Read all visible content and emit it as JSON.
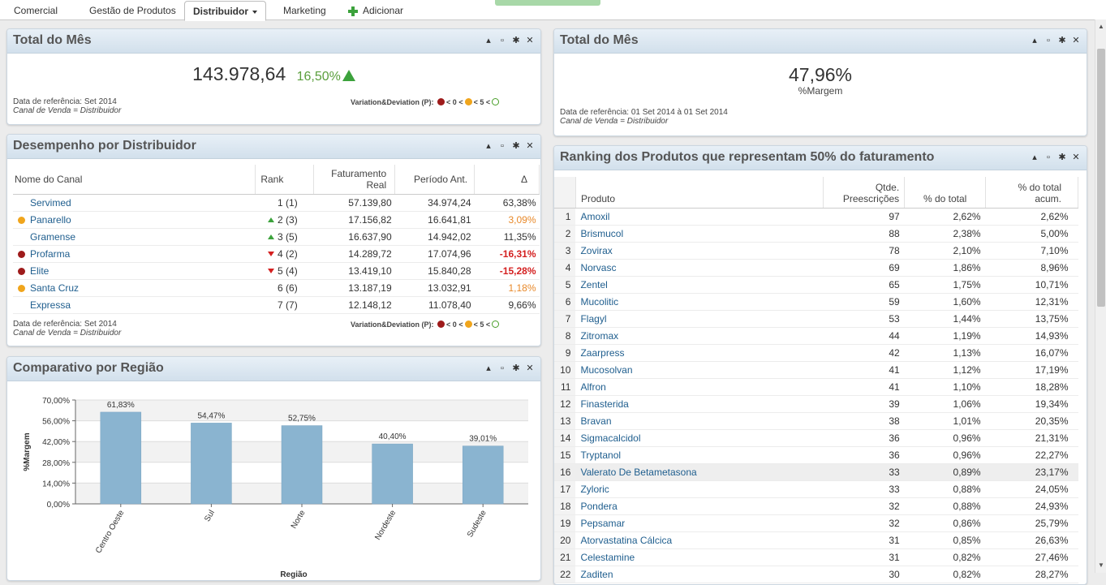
{
  "tabs": [
    {
      "label": "Comercial"
    },
    {
      "label": "Gestão de Produtos"
    },
    {
      "label": "Distribuidor"
    },
    {
      "label": "Marketing"
    },
    {
      "label": "Adicionar"
    }
  ],
  "panel_total_left": {
    "title": "Total do Mês",
    "value": "143.978,64",
    "variation": "16,50%",
    "ref_line1": "Data de referência: Set 2014",
    "ref_line2": "Canal de Venda = Distribuidor",
    "legend_label": "Variation&Deviation (P):",
    "legend_lt0": "< 0",
    "legend_lt5a": "<",
    "legend_lt5b": "< 5",
    "legend_lt5c": "<"
  },
  "panel_total_right": {
    "title": "Total do Mês",
    "value": "47,96%",
    "label": "%Margem",
    "ref_line1": "Data de referência: 01 Set 2014 à 01 Set 2014",
    "ref_line2": "Canal de Venda = Distribuidor"
  },
  "panel_desempenho": {
    "title": "Desempenho por Distribuidor",
    "headers": [
      "Nome do Canal",
      "Rank",
      "Faturamento Real",
      "Período Ant.",
      "Δ"
    ],
    "rows": [
      {
        "name": "Servimed",
        "status": "none",
        "trend": "none",
        "rank": "1",
        "prev_rank": "(1)",
        "faturamento": "57.139,80",
        "periodo": "34.974,24",
        "delta": "63,38%",
        "delta_style": "normal"
      },
      {
        "name": "Panarello",
        "status": "orange",
        "trend": "up",
        "rank": "2",
        "prev_rank": "(3)",
        "faturamento": "17.156,82",
        "periodo": "16.641,81",
        "delta": "3,09%",
        "delta_style": "warn"
      },
      {
        "name": "Gramense",
        "status": "none",
        "trend": "up",
        "rank": "3",
        "prev_rank": "(5)",
        "faturamento": "16.637,90",
        "periodo": "14.942,02",
        "delta": "11,35%",
        "delta_style": "normal"
      },
      {
        "name": "Profarma",
        "status": "red",
        "trend": "down",
        "rank": "4",
        "prev_rank": "(2)",
        "faturamento": "14.289,72",
        "periodo": "17.074,96",
        "delta": "-16,31%",
        "delta_style": "neg"
      },
      {
        "name": "Elite",
        "status": "red",
        "trend": "down",
        "rank": "5",
        "prev_rank": "(4)",
        "faturamento": "13.419,10",
        "periodo": "15.840,28",
        "delta": "-15,28%",
        "delta_style": "neg"
      },
      {
        "name": "Santa Cruz",
        "status": "orange",
        "trend": "none",
        "rank": "6",
        "prev_rank": "(6)",
        "faturamento": "13.187,19",
        "periodo": "13.032,91",
        "delta": "1,18%",
        "delta_style": "warn"
      },
      {
        "name": "Expressa",
        "status": "none",
        "trend": "none",
        "rank": "7",
        "prev_rank": "(7)",
        "faturamento": "12.148,12",
        "periodo": "11.078,40",
        "delta": "9,66%",
        "delta_style": "normal"
      }
    ],
    "ref_line1": "Data de referência: Set 2014",
    "ref_line2": "Canal de Venda = Distribuidor",
    "legend_label": "Variation&Deviation (P):",
    "legend_lt0": "< 0",
    "legend_lt5a": "<",
    "legend_lt5b": "< 5",
    "legend_lt5c": "<"
  },
  "panel_comparativo": {
    "title": "Comparativo por Região"
  },
  "chart_data": {
    "type": "bar",
    "categories": [
      "Centro Oeste",
      "Sul",
      "Norte",
      "Nordeste",
      "Sudeste"
    ],
    "values": [
      61.83,
      54.47,
      52.75,
      40.4,
      39.01
    ],
    "value_labels": [
      "61,83%",
      "54,47%",
      "52,75%",
      "40,40%",
      "39,01%"
    ],
    "ylabel": "%Margem",
    "xlabel": "Região",
    "ylim": [
      0,
      70
    ],
    "yticks": [
      0,
      14,
      28,
      42,
      56,
      70
    ],
    "ytick_labels": [
      "0,00%",
      "14,00%",
      "28,00%",
      "42,00%",
      "56,00%",
      "70,00%"
    ],
    "bar_color": "#8ab4d0",
    "grid": "alternating bands"
  },
  "panel_ranking": {
    "title": "Ranking dos Produtos que representam 50% do faturamento",
    "headers": [
      "Produto",
      "Qtde. Preescrições",
      "% do total",
      "% do total acum."
    ],
    "rows": [
      {
        "idx": "1",
        "produto": "Amoxil",
        "qtde": "97",
        "pct": "2,62%",
        "acum": "2,62%"
      },
      {
        "idx": "2",
        "produto": "Brismucol",
        "qtde": "88",
        "pct": "2,38%",
        "acum": "5,00%"
      },
      {
        "idx": "3",
        "produto": "Zovirax",
        "qtde": "78",
        "pct": "2,10%",
        "acum": "7,10%"
      },
      {
        "idx": "4",
        "produto": "Norvasc",
        "qtde": "69",
        "pct": "1,86%",
        "acum": "8,96%"
      },
      {
        "idx": "5",
        "produto": "Zentel",
        "qtde": "65",
        "pct": "1,75%",
        "acum": "10,71%"
      },
      {
        "idx": "6",
        "produto": "Mucolitic",
        "qtde": "59",
        "pct": "1,60%",
        "acum": "12,31%"
      },
      {
        "idx": "7",
        "produto": "Flagyl",
        "qtde": "53",
        "pct": "1,44%",
        "acum": "13,75%"
      },
      {
        "idx": "8",
        "produto": "Zitromax",
        "qtde": "44",
        "pct": "1,19%",
        "acum": "14,93%"
      },
      {
        "idx": "9",
        "produto": "Zaarpress",
        "qtde": "42",
        "pct": "1,13%",
        "acum": "16,07%"
      },
      {
        "idx": "10",
        "produto": "Mucosolvan",
        "qtde": "41",
        "pct": "1,12%",
        "acum": "17,19%"
      },
      {
        "idx": "11",
        "produto": "Alfron",
        "qtde": "41",
        "pct": "1,10%",
        "acum": "18,28%"
      },
      {
        "idx": "12",
        "produto": "Finasterida",
        "qtde": "39",
        "pct": "1,06%",
        "acum": "19,34%"
      },
      {
        "idx": "13",
        "produto": "Bravan",
        "qtde": "38",
        "pct": "1,01%",
        "acum": "20,35%"
      },
      {
        "idx": "14",
        "produto": "Sigmacalcidol",
        "qtde": "36",
        "pct": "0,96%",
        "acum": "21,31%"
      },
      {
        "idx": "15",
        "produto": "Tryptanol",
        "qtde": "36",
        "pct": "0,96%",
        "acum": "22,27%"
      },
      {
        "idx": "16",
        "produto": "Valerato De Betametasona",
        "qtde": "33",
        "pct": "0,89%",
        "acum": "23,17%"
      },
      {
        "idx": "17",
        "produto": "Zyloric",
        "qtde": "33",
        "pct": "0,88%",
        "acum": "24,05%"
      },
      {
        "idx": "18",
        "produto": "Pondera",
        "qtde": "32",
        "pct": "0,88%",
        "acum": "24,93%"
      },
      {
        "idx": "19",
        "produto": "Pepsamar",
        "qtde": "32",
        "pct": "0,86%",
        "acum": "25,79%"
      },
      {
        "idx": "20",
        "produto": "Atorvastatina Cálcica",
        "qtde": "31",
        "pct": "0,85%",
        "acum": "26,63%"
      },
      {
        "idx": "21",
        "produto": "Celestamine",
        "qtde": "31",
        "pct": "0,82%",
        "acum": "27,46%"
      },
      {
        "idx": "22",
        "produto": "Zaditen",
        "qtde": "30",
        "pct": "0,82%",
        "acum": "28,27%"
      }
    ]
  },
  "colors": {
    "accent_green": "#3ca23c",
    "negative_red": "#d42020",
    "warning_orange": "#e8892a",
    "link_blue": "#1f5e8e",
    "header_gradient": "#d2e0ec"
  },
  "icons": {
    "minimize": "▴",
    "maximize": "▫",
    "settings": "✱",
    "close": "✕"
  }
}
